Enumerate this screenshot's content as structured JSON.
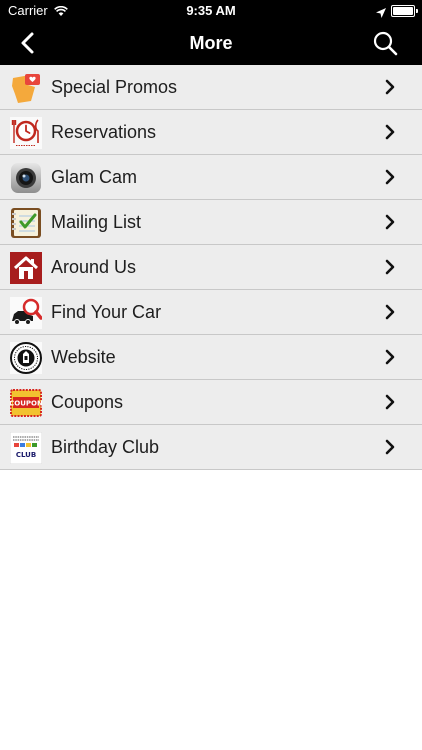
{
  "status": {
    "carrier": "Carrier",
    "time": "9:35 AM"
  },
  "nav": {
    "title": "More"
  },
  "icons": {
    "back": "chevron-left-icon",
    "search": "search-icon",
    "row_chevron": "chevron-right-icon"
  },
  "items": [
    {
      "label": "Special Promos",
      "icon": "special-promos-icon"
    },
    {
      "label": "Reservations",
      "icon": "reservations-icon"
    },
    {
      "label": "Glam Cam",
      "icon": "camera-icon"
    },
    {
      "label": "Mailing List",
      "icon": "mailing-list-icon"
    },
    {
      "label": "Around Us",
      "icon": "home-icon"
    },
    {
      "label": "Find Your Car",
      "icon": "find-car-icon"
    },
    {
      "label": "Website",
      "icon": "website-icon"
    },
    {
      "label": "Coupons",
      "icon": "coupons-icon"
    },
    {
      "label": "Birthday Club",
      "icon": "birthday-club-icon"
    }
  ],
  "coupon_badge": "COUPON",
  "birthday_badge": "CLUB"
}
